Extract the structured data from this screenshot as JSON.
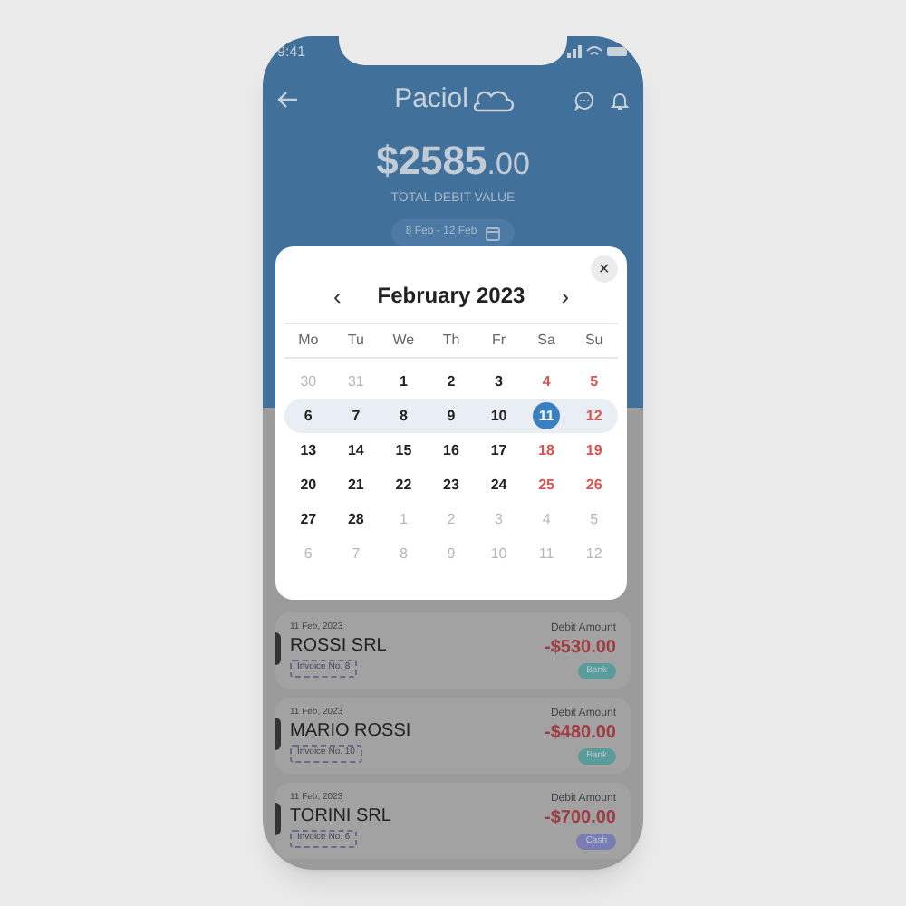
{
  "status_bar": {
    "time": "9:41"
  },
  "header": {
    "logo": "Paciol",
    "total": "$2585",
    "total_decimals": ".00",
    "total_label": "TOTAL DEBIT VALUE",
    "date_range": "8 Feb - 12 Feb"
  },
  "calendar": {
    "title": "February 2023",
    "prev": "‹",
    "next": "›",
    "close": "✕",
    "weekdays": [
      "Mo",
      "Tu",
      "We",
      "Th",
      "Fr",
      "Sa",
      "Su"
    ],
    "weeks": [
      [
        {
          "day": "30",
          "kind": "muted"
        },
        {
          "day": "31",
          "kind": "muted"
        },
        {
          "day": "1",
          "kind": "normal"
        },
        {
          "day": "2",
          "kind": "normal"
        },
        {
          "day": "3",
          "kind": "normal"
        },
        {
          "day": "4",
          "kind": "weekend"
        },
        {
          "day": "5",
          "kind": "weekend"
        }
      ],
      [
        {
          "day": "6",
          "kind": "normal",
          "in_range": true
        },
        {
          "day": "7",
          "kind": "normal",
          "in_range": true
        },
        {
          "day": "8",
          "kind": "normal",
          "in_range": true
        },
        {
          "day": "9",
          "kind": "normal",
          "in_range": true
        },
        {
          "day": "10",
          "kind": "normal",
          "in_range": true
        },
        {
          "day": "11",
          "kind": "weekend",
          "in_range": true,
          "selected": true
        },
        {
          "day": "12",
          "kind": "weekend",
          "in_range": true
        }
      ],
      [
        {
          "day": "13",
          "kind": "normal"
        },
        {
          "day": "14",
          "kind": "normal"
        },
        {
          "day": "15",
          "kind": "normal"
        },
        {
          "day": "16",
          "kind": "normal"
        },
        {
          "day": "17",
          "kind": "normal"
        },
        {
          "day": "18",
          "kind": "weekend"
        },
        {
          "day": "19",
          "kind": "weekend"
        }
      ],
      [
        {
          "day": "20",
          "kind": "normal"
        },
        {
          "day": "21",
          "kind": "normal"
        },
        {
          "day": "22",
          "kind": "normal"
        },
        {
          "day": "23",
          "kind": "normal"
        },
        {
          "day": "24",
          "kind": "normal"
        },
        {
          "day": "25",
          "kind": "weekend"
        },
        {
          "day": "26",
          "kind": "weekend"
        }
      ],
      [
        {
          "day": "27",
          "kind": "normal"
        },
        {
          "day": "28",
          "kind": "normal"
        },
        {
          "day": "1",
          "kind": "muted"
        },
        {
          "day": "2",
          "kind": "muted"
        },
        {
          "day": "3",
          "kind": "muted"
        },
        {
          "day": "4",
          "kind": "muted"
        },
        {
          "day": "5",
          "kind": "muted"
        }
      ],
      [
        {
          "day": "6",
          "kind": "muted"
        },
        {
          "day": "7",
          "kind": "muted"
        },
        {
          "day": "8",
          "kind": "muted"
        },
        {
          "day": "9",
          "kind": "muted"
        },
        {
          "day": "10",
          "kind": "muted"
        },
        {
          "day": "11",
          "kind": "muted"
        },
        {
          "day": "12",
          "kind": "muted"
        }
      ]
    ]
  },
  "transactions": [
    {
      "date": "11 Feb, 2023",
      "name": "ROSSI SRL",
      "invoice": "Invoice No. 8",
      "amount_label": "Debit Amount",
      "amount": "-$530.00",
      "method": "Bank",
      "color": "#5a9c9c"
    },
    {
      "date": "11 Feb, 2023",
      "name": "MARIO ROSSI",
      "invoice": "Invoice No. 10",
      "amount_label": "Debit Amount",
      "amount": "-$480.00",
      "method": "Bank",
      "color": "#5a9c9c"
    },
    {
      "date": "11 Feb, 2023",
      "name": "TORINI SRL",
      "invoice": "Invoice No. 6",
      "amount_label": "Debit Amount",
      "amount": "-$700.00",
      "method": "Cash",
      "color": "#7a7cb4"
    }
  ]
}
